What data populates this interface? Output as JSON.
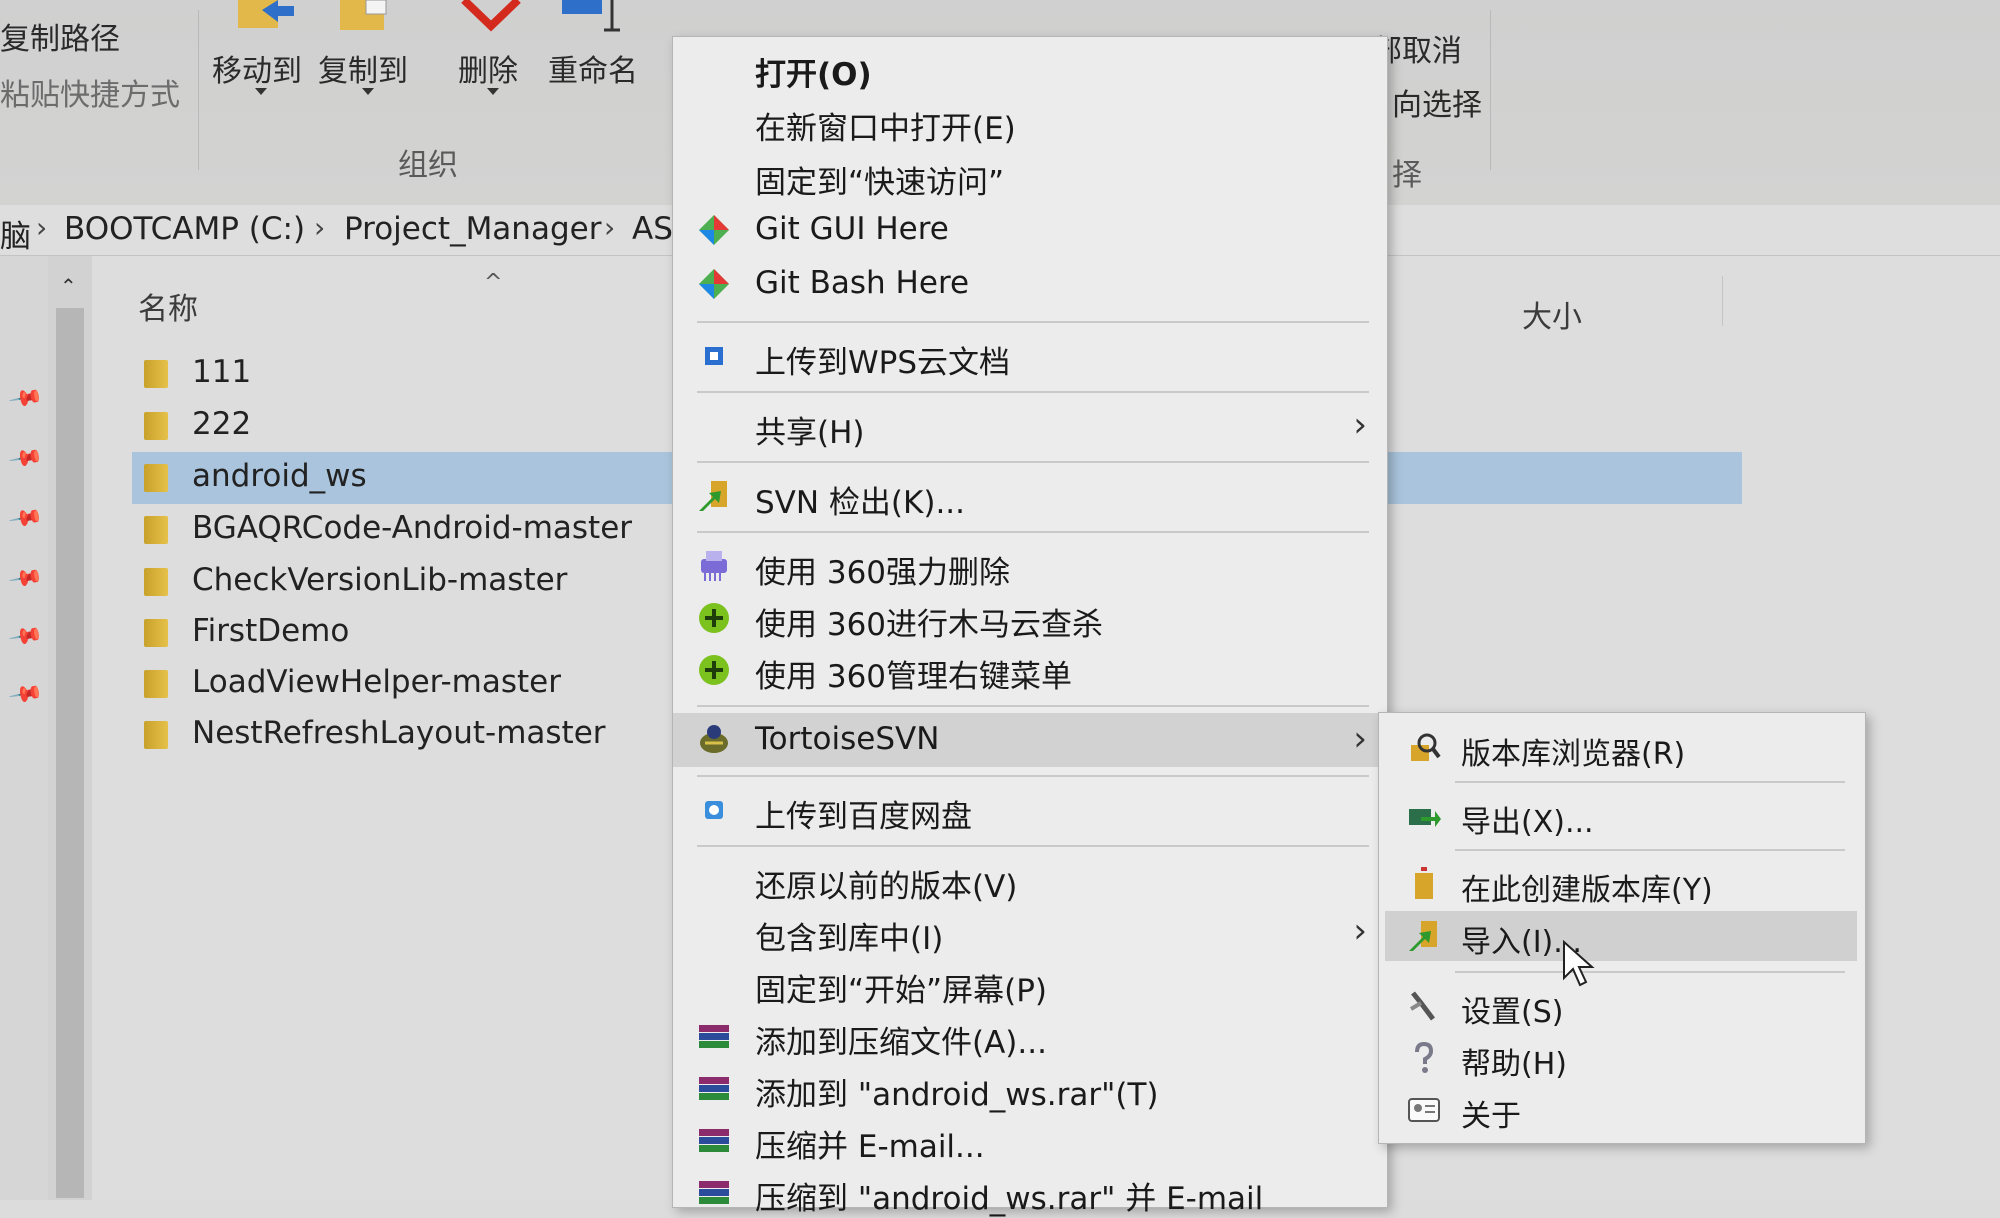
{
  "ribbon": {
    "copy_path": "复制路径",
    "paste_shortcut": "粘贴快捷方式",
    "move_to": "移动到",
    "copy_to": "复制到",
    "delete": "删除",
    "rename": "重命名",
    "group_organize": "组织",
    "deselect_all": "部取消",
    "invert_selection": "向选择",
    "group_select": "择"
  },
  "address": {
    "crumbs": [
      "BOOTCAMP (C:)",
      "Project_Manager",
      "AS"
    ],
    "leading_fragment": "脑"
  },
  "filelist": {
    "col_name": "名称",
    "col_size": "大小",
    "items": [
      "111",
      "222",
      "android_ws",
      "BGAQRCode-Android-master",
      "CheckVersionLib-master",
      "FirstDemo",
      "LoadViewHelper-master",
      "NestRefreshLayout-master"
    ],
    "selected": "android_ws"
  },
  "context_menu": {
    "items": [
      "打开(O)",
      "在新窗口中打开(E)",
      "固定到“快速访问”",
      "Git GUI Here",
      "Git Bash Here",
      "上传到WPS云文档",
      "共享(H)",
      "SVN 检出(K)...",
      "使用 360强力删除",
      "使用 360进行木马云查杀",
      "使用 360管理右键菜单",
      "TortoiseSVN",
      "上传到百度网盘",
      "还原以前的版本(V)",
      "包含到库中(I)",
      "固定到“开始”屏幕(P)",
      "添加到压缩文件(A)...",
      "添加到 \"android_ws.rar\"(T)",
      "压缩并 E-mail...",
      "压缩到 \"android_ws.rar\" 并 E-mail"
    ]
  },
  "submenu": {
    "items": [
      "版本库浏览器(R)",
      "导出(X)...",
      "在此创建版本库(Y)",
      "导入(I)...",
      "设置(S)",
      "帮助(H)",
      "关于"
    ],
    "highlighted": "导入(I)..."
  },
  "colors": {
    "selection": "#a9c4dc",
    "menu_bg": "#ececec",
    "folder": "#e0b93c",
    "delete_red": "#d42a1e"
  }
}
